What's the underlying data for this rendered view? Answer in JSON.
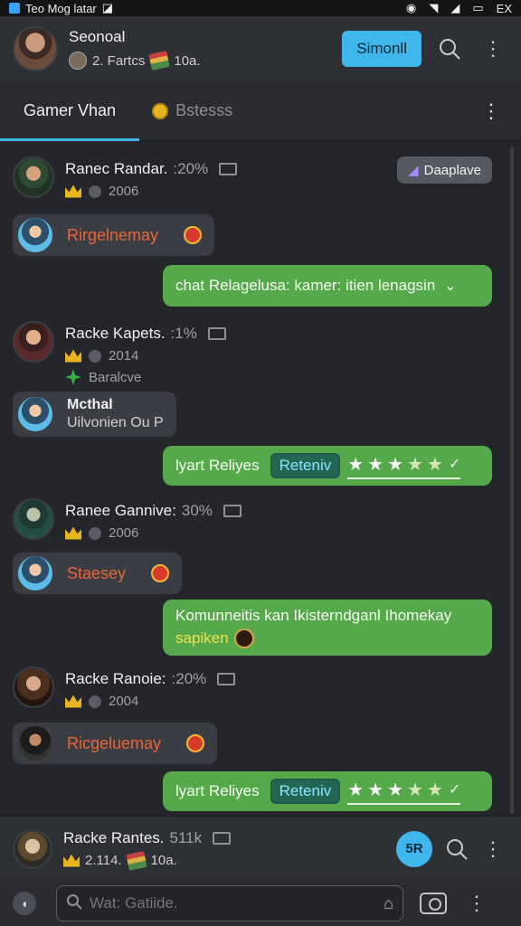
{
  "status": {
    "left": "Teo Mog latar",
    "right": "EX"
  },
  "header": {
    "name": "Seonoal",
    "sub1": "2. Fartcs",
    "sub2": "10a.",
    "join_label": "Simonll"
  },
  "tabs": {
    "active": "Gamer Vhan",
    "inactive": "Bstesss"
  },
  "messages": [
    {
      "name": "Ranec Randar.",
      "pct": ":20%",
      "year": "2006",
      "badge": "Daaplave"
    },
    {
      "bubble": "Rirgelnemay"
    },
    {
      "text": "chat Relagelusa: kamer: itien lenagsin"
    },
    {
      "name": "Racke Kapets.",
      "pct": ":1%",
      "year": "2014",
      "note": "Baralcve"
    },
    {
      "bubble_title": "Mcthal",
      "bubble_sub": "Uilvonien Ou P"
    },
    {
      "reply_label": "lyart Reliyes",
      "reply_box": "Reteniv",
      "rating": 5
    },
    {
      "name": "Ranee Gannive:",
      "pct": "30%",
      "year": "2006"
    },
    {
      "bubble": "Staesey"
    },
    {
      "text": "Komunneitis kan Ikisterndganl Ihomekay",
      "text2": "sapiken"
    },
    {
      "name": "Racke Ranoie:",
      "pct": ":20%",
      "year": "2004"
    },
    {
      "bubble": "Ricgeluemay"
    },
    {
      "reply_label": "lyart Reliyes",
      "reply_box": "Reteniv",
      "rating": 5
    }
  ],
  "footer": {
    "name": "Racke Rantes.",
    "pct": "511k",
    "sub1": "2.114.",
    "sub2": "10a.",
    "fab": "5R"
  },
  "input": {
    "placeholder": "Wat: Gatiide."
  },
  "colors": {
    "accent": "#3fb6ec",
    "bubble_green": "#56a94b",
    "bubble_dark": "#3a3d43",
    "orange_name": "#e9653a"
  }
}
